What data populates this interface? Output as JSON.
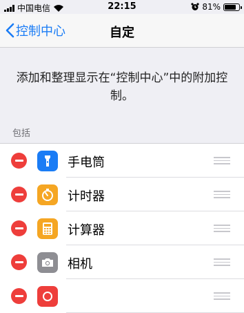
{
  "status_bar": {
    "carrier": "中国电信",
    "time": "22:15",
    "battery": "81%",
    "battery_level": 0.81,
    "icons": [
      "signal-icon",
      "wifi-icon",
      "alarm-icon",
      "battery-icon"
    ]
  },
  "nav": {
    "back_label": "控制中心",
    "title": "自定"
  },
  "description": "添加和整理显示在“控制中心”中的附加控制。",
  "section_header": "包括",
  "items": [
    {
      "label": "手电筒",
      "icon": "flashlight-icon",
      "color": "#1a7cf5"
    },
    {
      "label": "计时器",
      "icon": "timer-icon",
      "color": "#f5a623"
    },
    {
      "label": "计算器",
      "icon": "calculator-icon",
      "color": "#f5a623"
    },
    {
      "label": "相机",
      "icon": "camera-icon",
      "color": "#8e8e93"
    },
    {
      "label": "",
      "icon": "app-icon",
      "color": "#ee3e3b"
    }
  ],
  "colors": {
    "accent": "#1a7cf5",
    "remove": "#ee3e3b",
    "background": "#efeff4"
  }
}
